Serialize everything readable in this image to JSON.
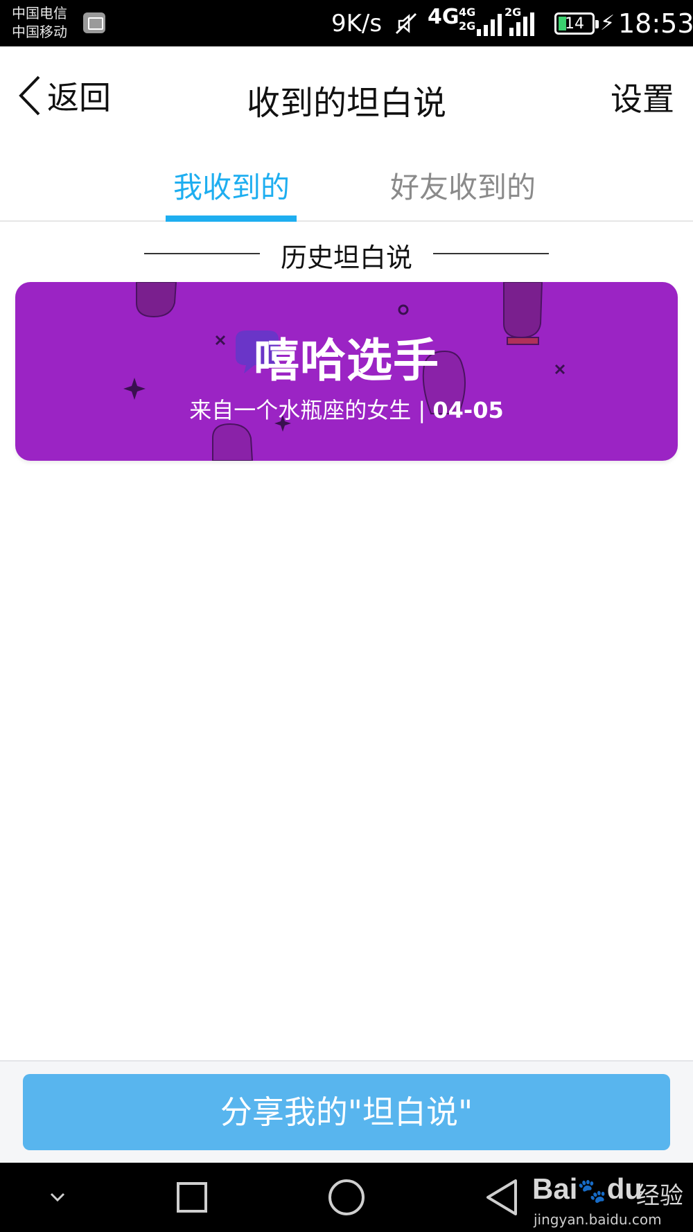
{
  "status_bar": {
    "carrier_1": "中国电信",
    "carrier_2": "中国移动",
    "net_speed": "9K/s",
    "network_4g": "4G",
    "network_4g_2g_top": "4G",
    "network_4g_2g_bottom": "2G",
    "network_2g": "2G",
    "battery_level": "14",
    "time": "18:53",
    "icons": [
      "gallery-icon",
      "mute-icon",
      "signal-icon",
      "battery-icon",
      "charging-icon"
    ]
  },
  "header": {
    "back_label": "返回",
    "title": "收到的坦白说",
    "settings_label": "设置"
  },
  "tabs": [
    {
      "label": "我收到的",
      "active": true
    },
    {
      "label": "好友收到的",
      "active": false
    }
  ],
  "section": {
    "title": "历史坦白说"
  },
  "card": {
    "title": "嘻哈选手",
    "subtitle": "来自一个水瓶座的女生 | ",
    "date": "04-05",
    "background_color": "#9b24c4"
  },
  "footer": {
    "share_label": "分享我的\"坦白说\"",
    "button_color": "#58b5ee"
  },
  "accent_color": "#1eaef0",
  "watermark": {
    "logo": "Bai",
    "logo_suffix": "du",
    "cn": "经验",
    "url": "jingyan.baidu.com"
  },
  "nav_bar": {
    "icons": [
      "collapse-chevron-icon",
      "recents-square-icon",
      "home-circle-icon",
      "back-triangle-icon"
    ]
  }
}
